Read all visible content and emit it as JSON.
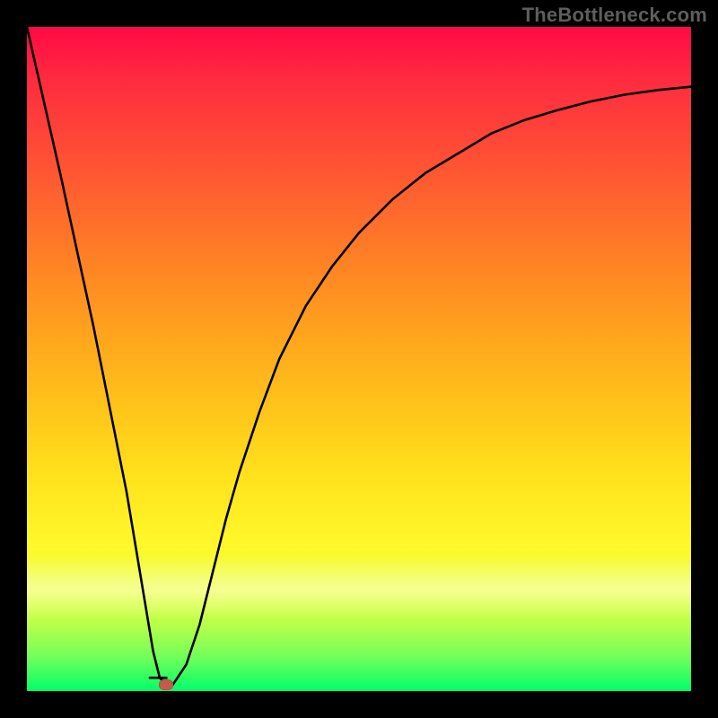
{
  "watermark": "TheBottleneck.com",
  "chart_data": {
    "type": "line",
    "title": "",
    "xlabel": "",
    "ylabel": "",
    "xlim": [
      0,
      100
    ],
    "ylim": [
      0,
      100
    ],
    "grid": false,
    "legend": false,
    "background": {
      "gradient_stops": [
        {
          "pos": 0.0,
          "color": "#ff0a45"
        },
        {
          "pos": 0.18,
          "color": "#ff4a36"
        },
        {
          "pos": 0.38,
          "color": "#ff8a22"
        },
        {
          "pos": 0.58,
          "color": "#ffc61a"
        },
        {
          "pos": 0.78,
          "color": "#fff82a"
        },
        {
          "pos": 0.9,
          "color": "#b8ff4a"
        },
        {
          "pos": 1.0,
          "color": "#00ff6a"
        }
      ]
    },
    "series": [
      {
        "name": "bottleneck-curve",
        "color": "#000000",
        "x": [
          0,
          5,
          10,
          15,
          17,
          19,
          20,
          21,
          22,
          24,
          26,
          28,
          30,
          32,
          35,
          38,
          42,
          46,
          50,
          55,
          60,
          65,
          70,
          75,
          80,
          85,
          90,
          95,
          100
        ],
        "y": [
          100,
          78,
          55,
          30,
          18,
          6,
          2,
          1,
          1,
          4,
          10,
          18,
          26,
          33,
          42,
          50,
          58,
          64,
          69,
          74,
          78,
          81,
          84,
          86,
          87.5,
          88.8,
          89.8,
          90.5,
          91
        ]
      }
    ],
    "marker": {
      "x": 21,
      "y": 1,
      "color": "#c65a4a"
    },
    "notch": {
      "x_start": 18.5,
      "x_end": 21,
      "y": 2
    }
  }
}
